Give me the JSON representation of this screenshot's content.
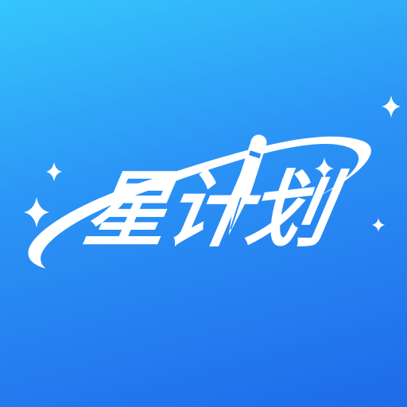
{
  "app_icon": {
    "logo_text": "星计划",
    "background": {
      "top": "#35c6fb",
      "bottom": "#1f6ae9"
    },
    "foreground_color": "#ffffff",
    "decorations": [
      "orbit-ring",
      "pen-nib-rocket",
      "sparkle-star"
    ]
  }
}
